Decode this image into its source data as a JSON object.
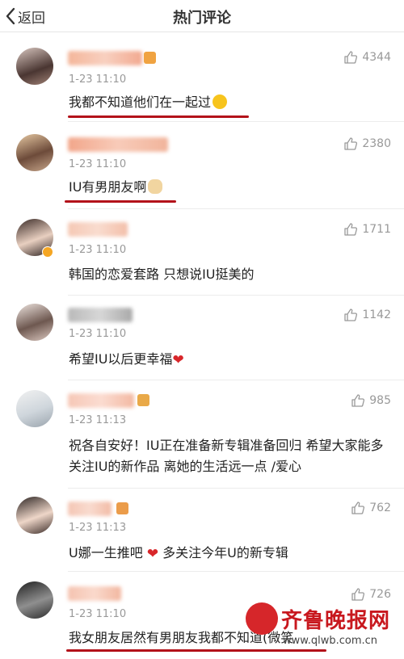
{
  "header": {
    "back_label": "返回",
    "title": "热门评论"
  },
  "comments": [
    {
      "time": "1-23 11:10",
      "likes": "4344",
      "text": "我都不知道他们在一起过"
    },
    {
      "time": "1-23 11:10",
      "likes": "2380",
      "text": "IU有男朋友啊"
    },
    {
      "time": "1-23 11:10",
      "likes": "1711",
      "text": "韩国的恋爱套路 只想说IU挺美的"
    },
    {
      "time": "1-23 11:10",
      "likes": "1142",
      "text": "希望IU以后更幸福"
    },
    {
      "time": "1-23 11:13",
      "likes": "985",
      "text": "祝各自安好！IU正在准备新专辑准备回归 希望大家能多关注IU的新作品 离她的生活远一点 /爱心"
    },
    {
      "time": "1-23 11:13",
      "likes": "762",
      "text": "U娜一生推吧"
    },
    {
      "time": "1-23 11:10",
      "likes": "726",
      "text": "我女朋友居然有男朋友我都不知道(微笑"
    }
  ],
  "comment6_extra": "多关注今年U的新专辑",
  "watermark": {
    "name": "齐鲁晚报网",
    "url": "www.qlwb.com.cn"
  },
  "colors": {
    "accent_red": "#b3121a",
    "meta_gray": "#999999",
    "text": "#222222"
  },
  "icons": [
    "chevron-left-icon",
    "thumbs-up-icon",
    "verified-badge-icon",
    "heart-icon",
    "laughing-emoji-icon",
    "doge-emoji-icon"
  ]
}
